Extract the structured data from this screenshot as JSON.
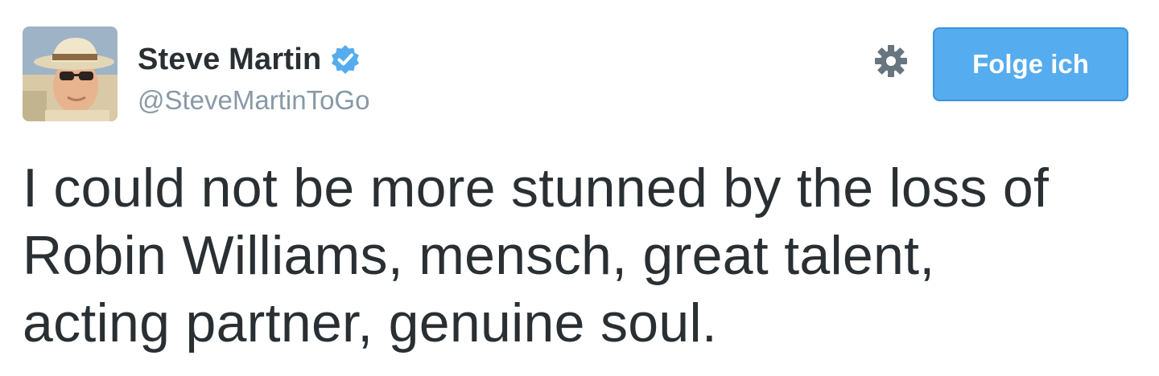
{
  "author": {
    "display_name": "Steve Martin",
    "handle": "@SteveMartinToGo",
    "verified": true
  },
  "icons": {
    "verified": "verified-badge-icon",
    "settings": "gear-icon"
  },
  "actions": {
    "follow_label": "Folge ich"
  },
  "tweet": {
    "text_lines": [
      "I could not be more stunned by the loss of",
      "Robin Williams, mensch, great talent,",
      "acting partner, genuine soul."
    ]
  },
  "colors": {
    "text": "#292f33",
    "handle": "#8899a6",
    "accent": "#55acee",
    "accent_border": "#3b94d9",
    "gear": "#66757f"
  }
}
